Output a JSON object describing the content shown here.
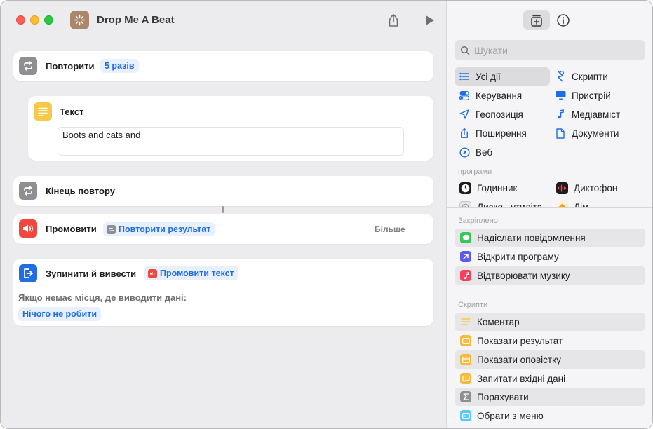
{
  "window": {
    "title": "Drop Me A Beat"
  },
  "actions": {
    "repeat": {
      "title": "Повторити",
      "count_token": "5 разів"
    },
    "text": {
      "title": "Текст",
      "content": "Boots and cats and"
    },
    "end_repeat": {
      "title": "Кінець повтору"
    },
    "speak": {
      "title": "Промовити",
      "token": "Повторити результат",
      "more_label": "Більше"
    },
    "stop_output": {
      "title": "Зупинити й вивести",
      "token": "Промовити текст",
      "no_place_label": "Якщо немає місця, де виводити дані:",
      "no_place_value": "Нічого не робити"
    }
  },
  "sidebar": {
    "search_placeholder": "Шукати",
    "categories": [
      {
        "label": "Усі дії",
        "icon": "list-icon",
        "selected": true
      },
      {
        "label": "Скрипти",
        "icon": "script-icon"
      },
      {
        "label": "Керування",
        "icon": "toggle-icon"
      },
      {
        "label": "Пристрій",
        "icon": "display-icon"
      },
      {
        "label": "Геопозиція",
        "icon": "location-arrow-icon"
      },
      {
        "label": "Медіавміст",
        "icon": "music-note-icon"
      },
      {
        "label": "Поширення",
        "icon": "share-icon"
      },
      {
        "label": "Документи",
        "icon": "document-icon"
      },
      {
        "label": "Веб",
        "icon": "compass-icon"
      }
    ],
    "apps_label": "програми",
    "apps": [
      {
        "label": "Годинник",
        "icon": "clock-app-icon"
      },
      {
        "label": "Диктофон",
        "icon": "voice-memos-app-icon"
      },
      {
        "label": "Диско...утиліта",
        "icon": "disk-utility-app-icon"
      },
      {
        "label": "Дім",
        "icon": "home-app-icon"
      }
    ],
    "pinned_label": "Закріплено",
    "pinned": [
      {
        "label": "Надіслати повідомлення",
        "icon": "messages-icon",
        "color": "#34c759"
      },
      {
        "label": "Відкрити програму",
        "icon": "open-app-icon",
        "color": "#5e5ce6"
      },
      {
        "label": "Відтворювати музику",
        "icon": "music-icon",
        "color": "#fa3e5e"
      }
    ],
    "scripts_label": "Скрипти",
    "scripts": [
      {
        "label": "Коментар",
        "icon": "comment-lines-icon",
        "color": "#f7c948"
      },
      {
        "label": "Показати результат",
        "icon": "show-result-icon",
        "color": "#f6b93b"
      },
      {
        "label": "Показати оповістку",
        "icon": "alert-icon",
        "color": "#f6b93b"
      },
      {
        "label": "Запитати вхідні дані",
        "icon": "ask-input-icon",
        "color": "#f6b93b"
      },
      {
        "label": "Порахувати",
        "icon": "sigma-icon",
        "color": "#8e8e93"
      },
      {
        "label": "Обрати з меню",
        "icon": "menu-icon",
        "color": "#5ac8fa"
      }
    ]
  }
}
